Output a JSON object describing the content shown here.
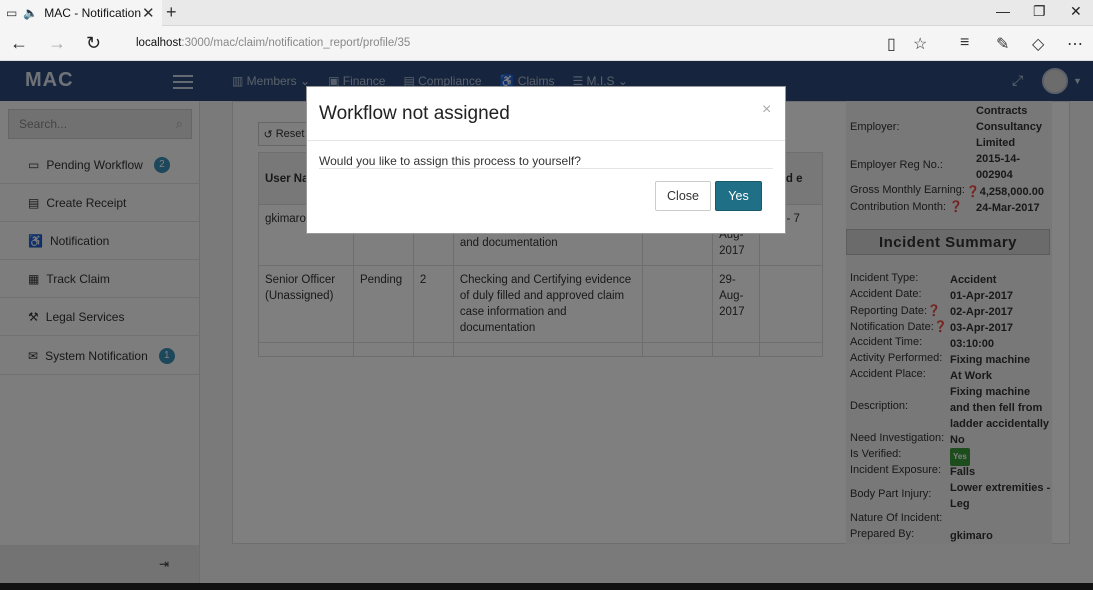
{
  "browser": {
    "tab_title": "MAC - Notification",
    "url_host": "localhost",
    "url_path": ":3000/mac/claim/notification_report/profile/35"
  },
  "app": {
    "logo": "MAC",
    "menu": [
      "Members",
      "Finance",
      "Compliance",
      "Claims",
      "M.I.S"
    ]
  },
  "sidebar": {
    "search_placeholder": "Search...",
    "items": [
      {
        "label": "Pending Workflow",
        "badge": "2"
      },
      {
        "label": "Create Receipt",
        "badge": ""
      },
      {
        "label": "Notification",
        "badge": ""
      },
      {
        "label": "Track Claim",
        "badge": ""
      },
      {
        "label": "Legal Services",
        "badge": ""
      },
      {
        "label": "System Notification",
        "badge": "1"
      }
    ]
  },
  "main": {
    "reset_label": "Reset",
    "table": {
      "headers": [
        "User Na",
        "",
        "",
        "",
        "",
        "ward e"
      ],
      "rows": [
        {
          "user": "gkimaro",
          "status": "",
          "level": "",
          "desc": "and documentation",
          "c5": "",
          "date": "Aug- 2017",
          "c7": "Aug- 7"
        },
        {
          "user": "Senior Officer (Unassigned)",
          "status": "Pending",
          "level": "2",
          "desc": "Checking and Certifying evidence of duly filled and approved claim case information and documentation",
          "c5": "",
          "date": "29- Aug- 2017",
          "c7": ""
        }
      ]
    }
  },
  "employer": {
    "employer_label": "Employer:",
    "employer_value": "Contracts Consultancy Limited",
    "reg_label": "Employer Reg No.:",
    "reg_value": "2015-14-002904",
    "earning_label": "Gross Monthly Earning:",
    "earning_value": "4,258,000.00",
    "contrib_label": "Contribution Month:",
    "contrib_value": "24-Mar-2017"
  },
  "incident": {
    "heading": "Incident Summary",
    "fields": [
      {
        "label": "Incident Type:",
        "value": "Accident"
      },
      {
        "label": "Accident Date:",
        "value": "01-Apr-2017"
      },
      {
        "label": "Reporting Date:",
        "value": "02-Apr-2017"
      },
      {
        "label": "Notification Date:",
        "value": "03-Apr-2017"
      },
      {
        "label": "Accident Time:",
        "value": "03:10:00"
      },
      {
        "label": "Activity Performed:",
        "value": "Fixing machine"
      },
      {
        "label": "Accident Place:",
        "value": "At Work"
      },
      {
        "label": "Description:",
        "value": "Fixing machine and then fell from ladder accidentally"
      },
      {
        "label": "Need Investigation:",
        "value": "No"
      },
      {
        "label": "Is Verified:",
        "value": "Yes"
      },
      {
        "label": "Incident Exposure:",
        "value": "Falls"
      },
      {
        "label": "Body Part Injury:",
        "value": "Lower extremities - Leg"
      },
      {
        "label": "Nature Of Incident:",
        "value": ""
      },
      {
        "label": "Prepared By:",
        "value": "gkimaro"
      }
    ]
  },
  "modal": {
    "title": "Workflow not assigned",
    "body": "Would you like to assign this process to yourself?",
    "close_label": "Close",
    "yes_label": "Yes"
  },
  "colors": {
    "header": "#2c4a7a",
    "primary_button": "#1f6f86",
    "badge": "#3a8fb7"
  }
}
